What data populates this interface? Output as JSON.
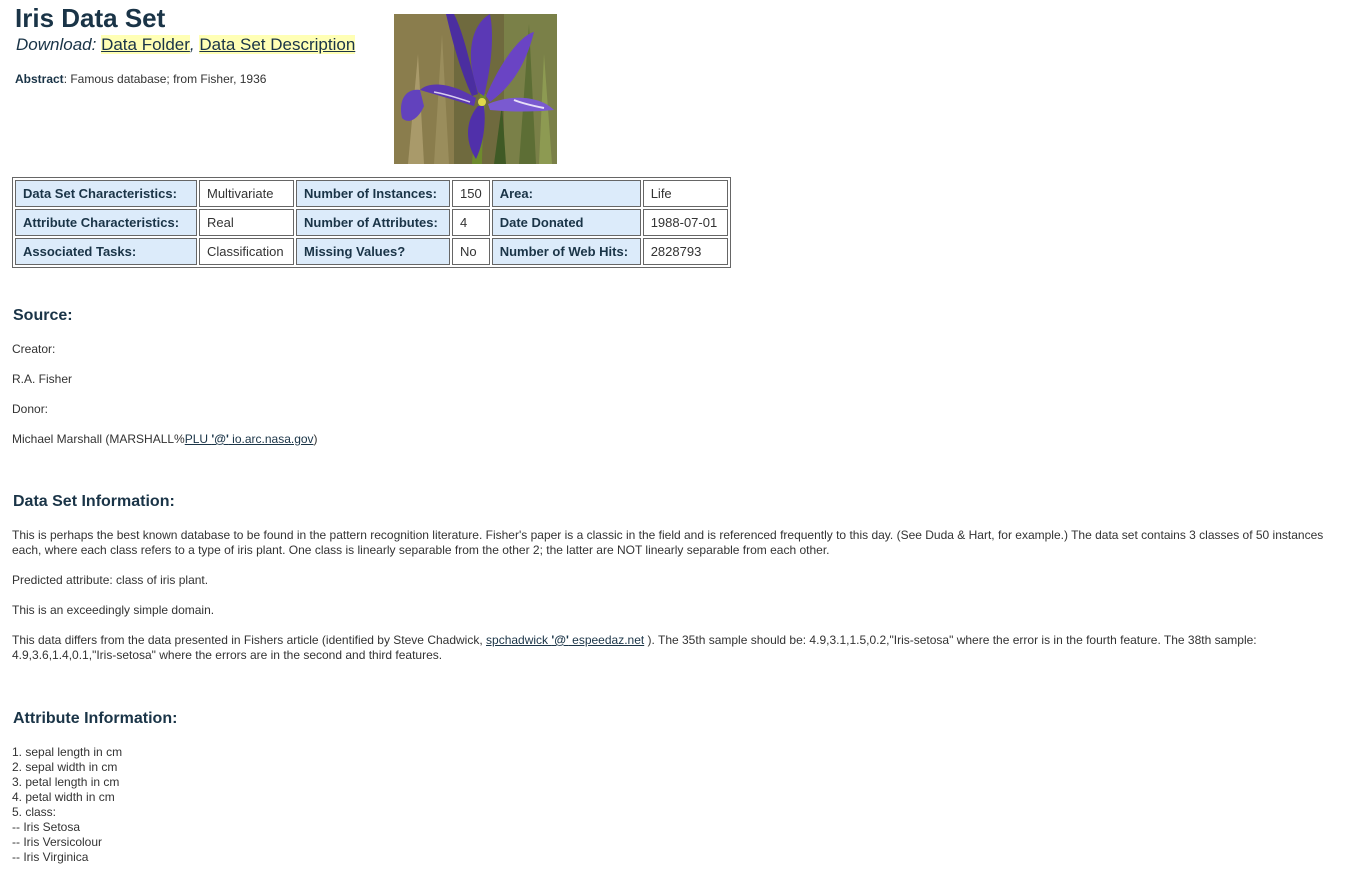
{
  "header": {
    "title": "Iris Data Set",
    "download_label": "Download",
    "download_sep": ":",
    "links": {
      "data_folder": "Data Folder",
      "comma": ",",
      "description": "Data Set Description"
    },
    "abstract_label": "Abstract",
    "abstract_text": ": Famous database; from Fisher, 1936"
  },
  "properties": {
    "rows": [
      {
        "label1": "Data Set Characteristics:",
        "value1": "Multivariate",
        "label2": "Number of Instances:",
        "value2": "150",
        "label3": "Area:",
        "value3": "Life"
      },
      {
        "label1": "Attribute Characteristics:",
        "value1": "Real",
        "label2": "Number of Attributes:",
        "value2": "4",
        "label3": "Date Donated",
        "value3": "1988-07-01"
      },
      {
        "label1": "Associated Tasks:",
        "value1": "Classification",
        "label2": "Missing Values?",
        "value2": "No",
        "label3": "Number of Web Hits:",
        "value3": "2828793"
      }
    ]
  },
  "source": {
    "heading": "Source:",
    "creator_label": "Creator:",
    "creator_name": "R.A. Fisher",
    "donor_label": "Donor:",
    "donor_prefix": "Michael Marshall (MARSHALL%",
    "donor_link_a": "PLU ",
    "donor_link_at": "'@'",
    "donor_link_b": " io.arc.nasa.gov",
    "donor_suffix": ")"
  },
  "info": {
    "heading": "Data Set Information:",
    "p1": "This is perhaps the best known database to be found in the pattern recognition literature. Fisher's paper is a classic in the field and is referenced frequently to this day. (See Duda & Hart, for example.) The data set contains 3 classes of 50 instances each, where each class refers to a type of iris plant. One class is linearly separable from the other 2; the latter are NOT linearly separable from each other.",
    "p2": "Predicted attribute: class of iris plant.",
    "p3": "This is an exceedingly simple domain.",
    "p4_prefix": "This data differs from the data presented in Fishers article (identified by Steve Chadwick, ",
    "p4_link_a": "spchadwick ",
    "p4_link_at": "'@'",
    "p4_link_b": " espeedaz.net",
    "p4_suffix": " ). The 35th sample should be: 4.9,3.1,1.5,0.2,\"Iris-setosa\" where the error is in the fourth feature. The 38th sample: 4.9,3.6,1.4,0.1,\"Iris-setosa\" where the errors are in the second and third features."
  },
  "attributes": {
    "heading": "Attribute Information:",
    "items": [
      "1. sepal length in cm",
      "2. sepal width in cm",
      "3. petal length in cm",
      "4. petal width in cm",
      "5. class:",
      "-- Iris Setosa",
      "-- Iris Versicolour",
      "-- Iris Virginica"
    ]
  },
  "colors": {
    "heading": "#1a3447",
    "label_bg": "#dcebfa",
    "link_highlight": "#ffffb5"
  }
}
